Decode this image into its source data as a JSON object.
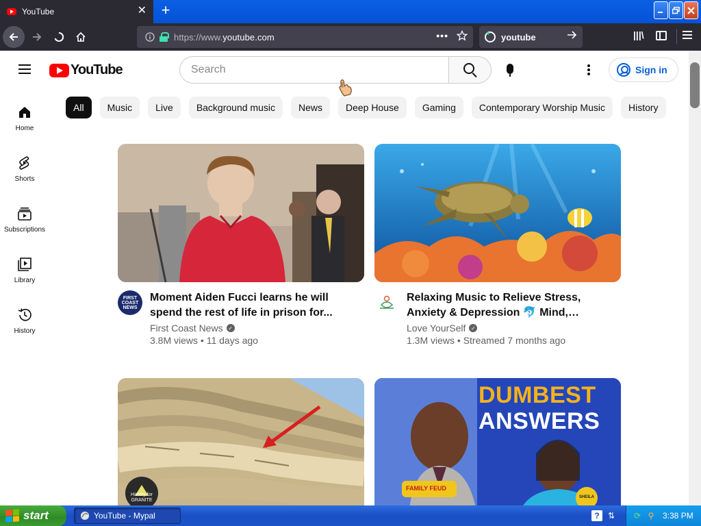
{
  "browser": {
    "tab_title": "YouTube",
    "tab_close": "✕",
    "new_tab": "+",
    "url_scheme": "https://www.",
    "url_host": "youtube.com",
    "search_text": "youtube",
    "page_actions": "•••"
  },
  "header": {
    "logo_text": "YouTube",
    "search_placeholder": "Search",
    "sign_in": "Sign in"
  },
  "chips": [
    "All",
    "Music",
    "Live",
    "Background music",
    "News",
    "Deep House",
    "Gaming",
    "Contemporary Worship Music",
    "History"
  ],
  "sidebar": {
    "items": [
      {
        "label": "Home",
        "icon": "home-icon"
      },
      {
        "label": "Shorts",
        "icon": "shorts-icon"
      },
      {
        "label": "Subscriptions",
        "icon": "subscriptions-icon"
      },
      {
        "label": "Library",
        "icon": "library-icon"
      },
      {
        "label": "History",
        "icon": "history-icon"
      }
    ]
  },
  "videos": [
    {
      "title": "Moment Aiden Fucci learns he will spend the rest of life in prison for...",
      "channel": "First Coast News",
      "stats": "3.8M views • 11 days ago",
      "avatar_text": "FIRST COAST NEWS"
    },
    {
      "title": "Relaxing Music to Relieve Stress, Anxiety & Depression 🐬 Mind, Body &...",
      "channel": "Love YourSelf",
      "stats": "1.3M views • Streamed 7 months ago"
    },
    {
      "thumb_text": "History for GRANITE"
    },
    {
      "thumb_line1": "DUMBEST",
      "thumb_line2": "ANSWERS",
      "thumb_badge": "FAMILY FEUD",
      "thumb_tag": "SHEILA"
    }
  ],
  "taskbar": {
    "start": "start",
    "window_title": "YouTube - Mypal",
    "clock": "3:38 PM"
  },
  "colors": {
    "youtube_red": "#ff0000",
    "link_blue": "#065fd4",
    "xp_blue": "#245edb",
    "xp_green": "#3a9a30"
  }
}
